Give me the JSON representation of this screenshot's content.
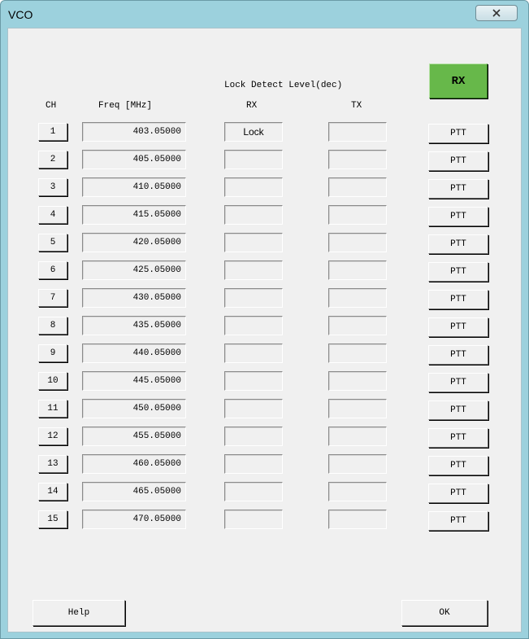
{
  "window": {
    "title": "VCO",
    "close_glyph": "✕",
    "close_icon": "close-icon"
  },
  "headers": {
    "lock_detect": "Lock Detect Level(dec)",
    "ch": "CH",
    "freq": "Freq [MHz]",
    "rx": "RX",
    "tx": "TX"
  },
  "rx_button": {
    "label": "RX",
    "color": "#67b84a"
  },
  "channels": [
    {
      "ch": "1",
      "freq": "403.05000",
      "rx": "Lock",
      "tx": "",
      "ptt": "PTT"
    },
    {
      "ch": "2",
      "freq": "405.05000",
      "rx": "",
      "tx": "",
      "ptt": "PTT"
    },
    {
      "ch": "3",
      "freq": "410.05000",
      "rx": "",
      "tx": "",
      "ptt": "PTT"
    },
    {
      "ch": "4",
      "freq": "415.05000",
      "rx": "",
      "tx": "",
      "ptt": "PTT"
    },
    {
      "ch": "5",
      "freq": "420.05000",
      "rx": "",
      "tx": "",
      "ptt": "PTT"
    },
    {
      "ch": "6",
      "freq": "425.05000",
      "rx": "",
      "tx": "",
      "ptt": "PTT"
    },
    {
      "ch": "7",
      "freq": "430.05000",
      "rx": "",
      "tx": "",
      "ptt": "PTT"
    },
    {
      "ch": "8",
      "freq": "435.05000",
      "rx": "",
      "tx": "",
      "ptt": "PTT"
    },
    {
      "ch": "9",
      "freq": "440.05000",
      "rx": "",
      "tx": "",
      "ptt": "PTT"
    },
    {
      "ch": "10",
      "freq": "445.05000",
      "rx": "",
      "tx": "",
      "ptt": "PTT"
    },
    {
      "ch": "11",
      "freq": "450.05000",
      "rx": "",
      "tx": "",
      "ptt": "PTT"
    },
    {
      "ch": "12",
      "freq": "455.05000",
      "rx": "",
      "tx": "",
      "ptt": "PTT"
    },
    {
      "ch": "13",
      "freq": "460.05000",
      "rx": "",
      "tx": "",
      "ptt": "PTT"
    },
    {
      "ch": "14",
      "freq": "465.05000",
      "rx": "",
      "tx": "",
      "ptt": "PTT"
    },
    {
      "ch": "15",
      "freq": "470.05000",
      "rx": "",
      "tx": "",
      "ptt": "PTT"
    }
  ],
  "footer": {
    "help": "Help",
    "ok": "OK"
  }
}
